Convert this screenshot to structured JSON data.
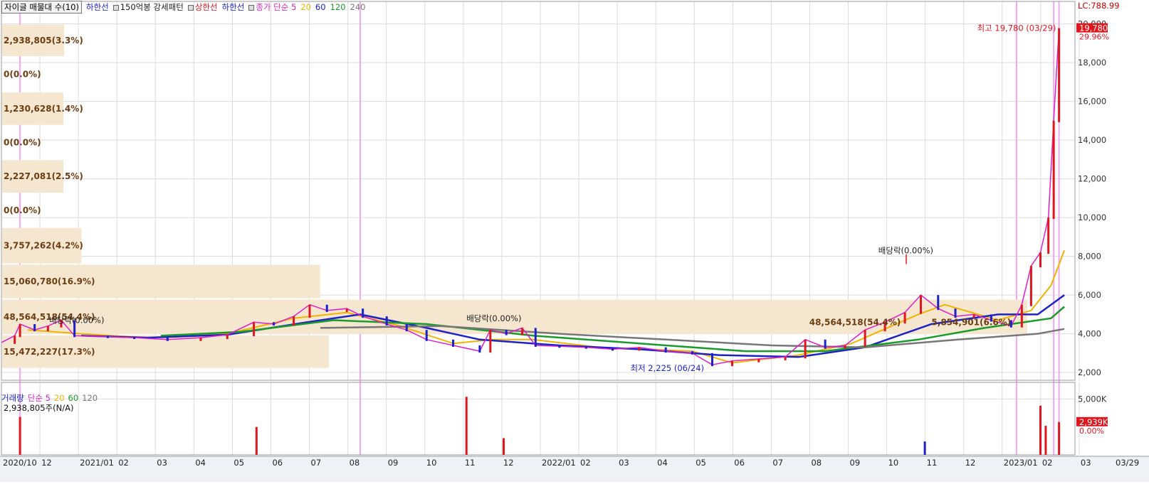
{
  "legend": {
    "title_box": "자이글 매물대 수(10)",
    "items": [
      {
        "text": "하한선",
        "color": "#1d22c8"
      },
      {
        "text": "150억봉 강세패턴",
        "color": "#222222",
        "square": true
      },
      {
        "text": "상한선",
        "color": "#e0161f",
        "square": true
      },
      {
        "text": "하한선",
        "color": "#1d22c8"
      },
      {
        "text": "종가 단순 5",
        "color": "#e01fc8",
        "square": true
      },
      {
        "text": "20",
        "color": "#f0b400"
      },
      {
        "text": "60",
        "color": "#1d22c8"
      },
      {
        "text": "120",
        "color": "#1a9a2a"
      },
      {
        "text": "240",
        "color": "#777777"
      }
    ]
  },
  "volume_legend": {
    "items": [
      {
        "text": "거래량",
        "color": "#1d22c8",
        "square": true
      },
      {
        "text": "단순 5",
        "color": "#e01fc8"
      },
      {
        "text": "20",
        "color": "#f0b400"
      },
      {
        "text": "60",
        "color": "#1a9a2a"
      },
      {
        "text": "120",
        "color": "#777777"
      }
    ],
    "last_volume": "2,938,805주(N/A)"
  },
  "right_top": "LC:788.99",
  "price_tag": {
    "value": "19,780",
    "pct": "29.96%"
  },
  "volume_tag": {
    "value": "2,939K",
    "pct": "0.00%"
  },
  "annotations": {
    "high": "최고 19,780 (03/29)",
    "low": "최저 2,225 (06/24)",
    "dividend_1": "배당락(0.00%)",
    "dividend_2": "배당락(0.00%)",
    "dividend_3": "배당락(0.00%)",
    "band_right_label": "48,564,518(54.4%)",
    "band_right_label_2": "5,854,901(6.6%)"
  },
  "colors": {
    "up": "#e0161f",
    "down": "#1d22c8",
    "ma5": "#e01fc8",
    "ma20": "#f0b400",
    "ma60": "#1d22c8",
    "ma120": "#1a9a2a",
    "ma240": "#777777",
    "volume_profile": "#f5e6d0",
    "grid": "#dcdcdc",
    "event_line": "#f2a8f0"
  },
  "chart_data": {
    "type": "line",
    "x_tick_labels": [
      "2020/10",
      "12",
      "2021/01",
      "02",
      "03",
      "04",
      "05",
      "06",
      "07",
      "08",
      "09",
      "10",
      "11",
      "12",
      "2022/01",
      "02",
      "03",
      "04",
      "05",
      "06",
      "07",
      "08",
      "09",
      "10",
      "11",
      "12",
      "2023/01",
      "02",
      "03",
      "03/29"
    ],
    "y_ticks": [
      "20,000",
      "18,000",
      "16,000",
      "14,000",
      "12,000",
      "10,000",
      "8,000",
      "6,000",
      "4,000",
      "2,000"
    ],
    "ylim": [
      1600,
      20500
    ],
    "volume_ticks": [
      "5,000K"
    ],
    "volume_profile": [
      {
        "label": "2,938,805(3.3%)",
        "low": 18300,
        "high": 20000,
        "volume": 2938805
      },
      {
        "label": "0(0.0%)",
        "low": 16500,
        "high": 18300,
        "volume": 0
      },
      {
        "label": "1,230,628(1.4%)",
        "low": 14750,
        "high": 16500,
        "volume": 1230628
      },
      {
        "label": "0(0.0%)",
        "low": 13000,
        "high": 14750,
        "volume": 0
      },
      {
        "label": "2,227,081(2.5%)",
        "low": 11250,
        "high": 13000,
        "volume": 2227081
      },
      {
        "label": "0(0.0%)",
        "low": 9500,
        "high": 11250,
        "volume": 0
      },
      {
        "label": "3,757,262(4.2%)",
        "low": 7600,
        "high": 9500,
        "volume": 3757262
      },
      {
        "label": "15,060,780(16.9%)",
        "low": 5800,
        "high": 7600,
        "volume": 15060780
      },
      {
        "label": "48,564,518(54.4%)",
        "low": 3950,
        "high": 5800,
        "volume": 48564518
      },
      {
        "label": "15,472,227(17.3%)",
        "low": 2200,
        "high": 3950,
        "volume": 15472227
      }
    ],
    "price_series": [
      {
        "t": 0,
        "v": 3550
      },
      {
        "t": 10,
        "v": 3900
      },
      {
        "t": 14,
        "v": 4500
      },
      {
        "t": 25,
        "v": 4200
      },
      {
        "t": 35,
        "v": 4400
      },
      {
        "t": 45,
        "v": 4700
      },
      {
        "t": 55,
        "v": 3900
      },
      {
        "t": 80,
        "v": 3850
      },
      {
        "t": 100,
        "v": 3800
      },
      {
        "t": 125,
        "v": 3700
      },
      {
        "t": 150,
        "v": 3800
      },
      {
        "t": 170,
        "v": 3950
      },
      {
        "t": 190,
        "v": 4600
      },
      {
        "t": 205,
        "v": 4500
      },
      {
        "t": 220,
        "v": 4900
      },
      {
        "t": 232,
        "v": 5500
      },
      {
        "t": 245,
        "v": 5200
      },
      {
        "t": 260,
        "v": 5300
      },
      {
        "t": 272,
        "v": 4900
      },
      {
        "t": 290,
        "v": 4500
      },
      {
        "t": 305,
        "v": 4200
      },
      {
        "t": 320,
        "v": 3700
      },
      {
        "t": 340,
        "v": 3400
      },
      {
        "t": 360,
        "v": 3100
      },
      {
        "t": 368,
        "v": 4200
      },
      {
        "t": 380,
        "v": 4000
      },
      {
        "t": 392,
        "v": 4300
      },
      {
        "t": 402,
        "v": 3400
      },
      {
        "t": 420,
        "v": 3350
      },
      {
        "t": 440,
        "v": 3300
      },
      {
        "t": 460,
        "v": 3200
      },
      {
        "t": 480,
        "v": 3300
      },
      {
        "t": 500,
        "v": 3100
      },
      {
        "t": 520,
        "v": 3000
      },
      {
        "t": 535,
        "v": 2400
      },
      {
        "t": 550,
        "v": 2600
      },
      {
        "t": 570,
        "v": 2700
      },
      {
        "t": 590,
        "v": 2800
      },
      {
        "t": 605,
        "v": 3700
      },
      {
        "t": 620,
        "v": 3300
      },
      {
        "t": 635,
        "v": 3400
      },
      {
        "t": 650,
        "v": 4200
      },
      {
        "t": 665,
        "v": 4600
      },
      {
        "t": 680,
        "v": 5100
      },
      {
        "t": 692,
        "v": 6000
      },
      {
        "t": 705,
        "v": 5300
      },
      {
        "t": 718,
        "v": 4900
      },
      {
        "t": 732,
        "v": 5000
      },
      {
        "t": 745,
        "v": 4700
      },
      {
        "t": 760,
        "v": 4400
      },
      {
        "t": 768,
        "v": 5500
      },
      {
        "t": 775,
        "v": 7500
      },
      {
        "t": 782,
        "v": 8200
      },
      {
        "t": 788,
        "v": 10000
      },
      {
        "t": 792,
        "v": 15000
      },
      {
        "t": 796,
        "v": 19780
      }
    ],
    "ma_series": [
      {
        "key": "ma20",
        "points": [
          {
            "t": 20,
            "v": 4200
          },
          {
            "t": 60,
            "v": 4000
          },
          {
            "t": 110,
            "v": 3800
          },
          {
            "t": 170,
            "v": 4000
          },
          {
            "t": 220,
            "v": 4800
          },
          {
            "t": 260,
            "v": 5100
          },
          {
            "t": 300,
            "v": 4400
          },
          {
            "t": 340,
            "v": 3500
          },
          {
            "t": 370,
            "v": 3700
          },
          {
            "t": 400,
            "v": 3700
          },
          {
            "t": 450,
            "v": 3300
          },
          {
            "t": 520,
            "v": 3100
          },
          {
            "t": 550,
            "v": 2500
          },
          {
            "t": 600,
            "v": 2900
          },
          {
            "t": 640,
            "v": 3500
          },
          {
            "t": 690,
            "v": 5000
          },
          {
            "t": 710,
            "v": 5500
          },
          {
            "t": 750,
            "v": 4700
          },
          {
            "t": 775,
            "v": 5200
          },
          {
            "t": 790,
            "v": 6500
          },
          {
            "t": 800,
            "v": 8300
          }
        ]
      },
      {
        "key": "ma60",
        "points": [
          {
            "t": 60,
            "v": 3900
          },
          {
            "t": 110,
            "v": 3800
          },
          {
            "t": 170,
            "v": 3950
          },
          {
            "t": 230,
            "v": 4600
          },
          {
            "t": 270,
            "v": 5000
          },
          {
            "t": 320,
            "v": 4300
          },
          {
            "t": 360,
            "v": 3700
          },
          {
            "t": 420,
            "v": 3400
          },
          {
            "t": 480,
            "v": 3200
          },
          {
            "t": 540,
            "v": 2900
          },
          {
            "t": 600,
            "v": 2800
          },
          {
            "t": 650,
            "v": 3300
          },
          {
            "t": 700,
            "v": 4500
          },
          {
            "t": 750,
            "v": 5000
          },
          {
            "t": 780,
            "v": 5000
          },
          {
            "t": 800,
            "v": 6000
          }
        ]
      },
      {
        "key": "ma120",
        "points": [
          {
            "t": 120,
            "v": 3900
          },
          {
            "t": 180,
            "v": 4100
          },
          {
            "t": 250,
            "v": 4700
          },
          {
            "t": 320,
            "v": 4500
          },
          {
            "t": 400,
            "v": 3900
          },
          {
            "t": 480,
            "v": 3500
          },
          {
            "t": 560,
            "v": 3100
          },
          {
            "t": 620,
            "v": 3100
          },
          {
            "t": 690,
            "v": 3700
          },
          {
            "t": 740,
            "v": 4300
          },
          {
            "t": 790,
            "v": 4800
          },
          {
            "t": 800,
            "v": 5400
          }
        ]
      },
      {
        "key": "ma240",
        "points": [
          {
            "t": 240,
            "v": 4300
          },
          {
            "t": 330,
            "v": 4400
          },
          {
            "t": 420,
            "v": 4000
          },
          {
            "t": 500,
            "v": 3700
          },
          {
            "t": 580,
            "v": 3400
          },
          {
            "t": 650,
            "v": 3300
          },
          {
            "t": 720,
            "v": 3700
          },
          {
            "t": 780,
            "v": 4000
          },
          {
            "t": 800,
            "v": 4250
          }
        ]
      }
    ],
    "volume_spikes": [
      {
        "t": 14,
        "v": 3400
      },
      {
        "t": 192,
        "v": 2500
      },
      {
        "t": 350,
        "v": 5200
      },
      {
        "t": 378,
        "v": 1500
      },
      {
        "t": 695,
        "v": 1200
      },
      {
        "t": 782,
        "v": 4400
      },
      {
        "t": 786,
        "v": 2600
      },
      {
        "t": 796,
        "v": 2939
      }
    ]
  }
}
